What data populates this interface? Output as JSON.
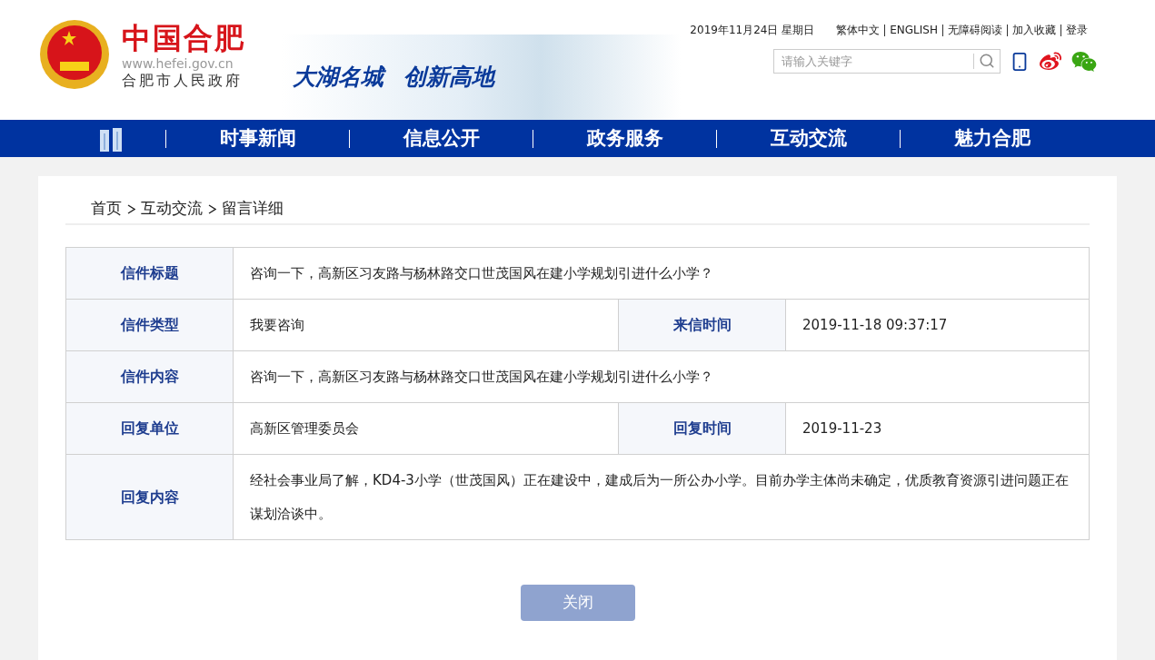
{
  "header": {
    "site_name": "中国合肥",
    "url": "www.hefei.gov.cn",
    "org_name": "合肥市人民政府",
    "slogan": [
      "大湖名城",
      "创新高地"
    ],
    "date": "2019年11月24日 星期日",
    "links": [
      "繁体中文",
      "ENGLISH",
      "无障碍阅读",
      "加入收藏",
      "登录"
    ],
    "search": {
      "placeholder": "请输入关键字"
    }
  },
  "nav": {
    "items": [
      "时事新闻",
      "信息公开",
      "政务服务",
      "互动交流",
      "魅力合肥"
    ]
  },
  "breadcrumb": [
    "首页",
    "互动交流",
    "留言详细"
  ],
  "details": [
    {
      "fields": [
        {
          "label": "信件标题",
          "value": "咨询一下，高新区习友路与杨林路交口世茂国风在建小学规划引进什么小学？"
        }
      ]
    },
    {
      "fields": [
        {
          "label": "信件类型",
          "value": "我要咨询"
        },
        {
          "label": "来信时间",
          "value": "2019-11-18 09:37:17"
        }
      ]
    },
    {
      "fields": [
        {
          "label": "信件内容",
          "value": "咨询一下，高新区习友路与杨林路交口世茂国风在建小学规划引进什么小学？"
        }
      ]
    },
    {
      "fields": [
        {
          "label": "回复单位",
          "value": "高新区管理委员会"
        },
        {
          "label": "回复时间",
          "value": "2019-11-23"
        }
      ]
    },
    {
      "fields": [
        {
          "label": "回复内容",
          "value": "经社会事业局了解，KD4-3小学（世茂国风）正在建设中，建成后为一所公办小学。目前办学主体尚未确定，优质教育资源引进问题正在谋划洽谈中。"
        }
      ]
    }
  ],
  "close_button": "关闭"
}
